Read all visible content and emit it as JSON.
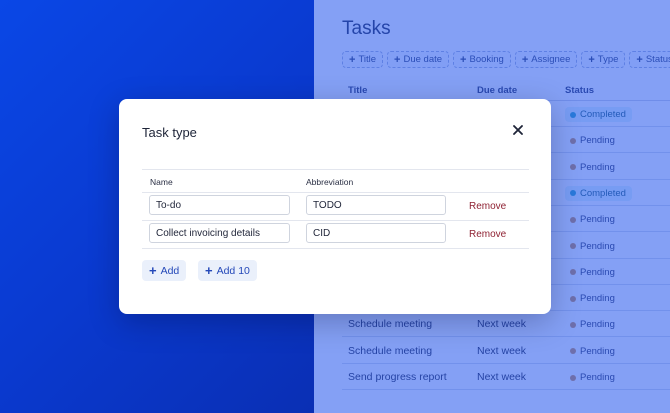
{
  "tasks_page": {
    "title": "Tasks",
    "filters": [
      "Title",
      "Due date",
      "Booking",
      "Assignee",
      "Type",
      "Status"
    ],
    "columns": {
      "title": "Title",
      "due_date": "Due date",
      "status": "Status"
    },
    "rows": [
      {
        "title": "",
        "due_date": "",
        "status": "Completed"
      },
      {
        "title": "",
        "due_date": "",
        "status": "Pending"
      },
      {
        "title": "",
        "due_date": "",
        "status": "Pending"
      },
      {
        "title": "",
        "due_date": "",
        "status": "Completed"
      },
      {
        "title": "",
        "due_date": "",
        "status": "Pending"
      },
      {
        "title": "",
        "due_date": "",
        "status": "Pending"
      },
      {
        "title": "",
        "due_date": "",
        "status": "Pending"
      },
      {
        "title": "",
        "due_date": "",
        "status": "Pending"
      },
      {
        "title": "Schedule meeting",
        "due_date": "Next week",
        "status": "Pending"
      },
      {
        "title": "Schedule meeting",
        "due_date": "Next week",
        "status": "Pending"
      },
      {
        "title": "Send progress report",
        "due_date": "Next week",
        "status": "Pending"
      }
    ]
  },
  "modal": {
    "title": "Task type",
    "close_icon": "close-icon",
    "columns": {
      "name": "Name",
      "abbreviation": "Abbreviation"
    },
    "rows": [
      {
        "name": "To-do",
        "abbreviation": "TODO",
        "remove_label": "Remove"
      },
      {
        "name": "Collect invoicing details",
        "abbreviation": "CID",
        "remove_label": "Remove"
      }
    ],
    "add_label": "Add",
    "add10_label": "Add 10"
  },
  "colors": {
    "brand_blue": "#0a47e6",
    "remove_red": "#8f2233",
    "completed_dot": "#2aa0c0",
    "pending_dot": "#c48a5a"
  }
}
